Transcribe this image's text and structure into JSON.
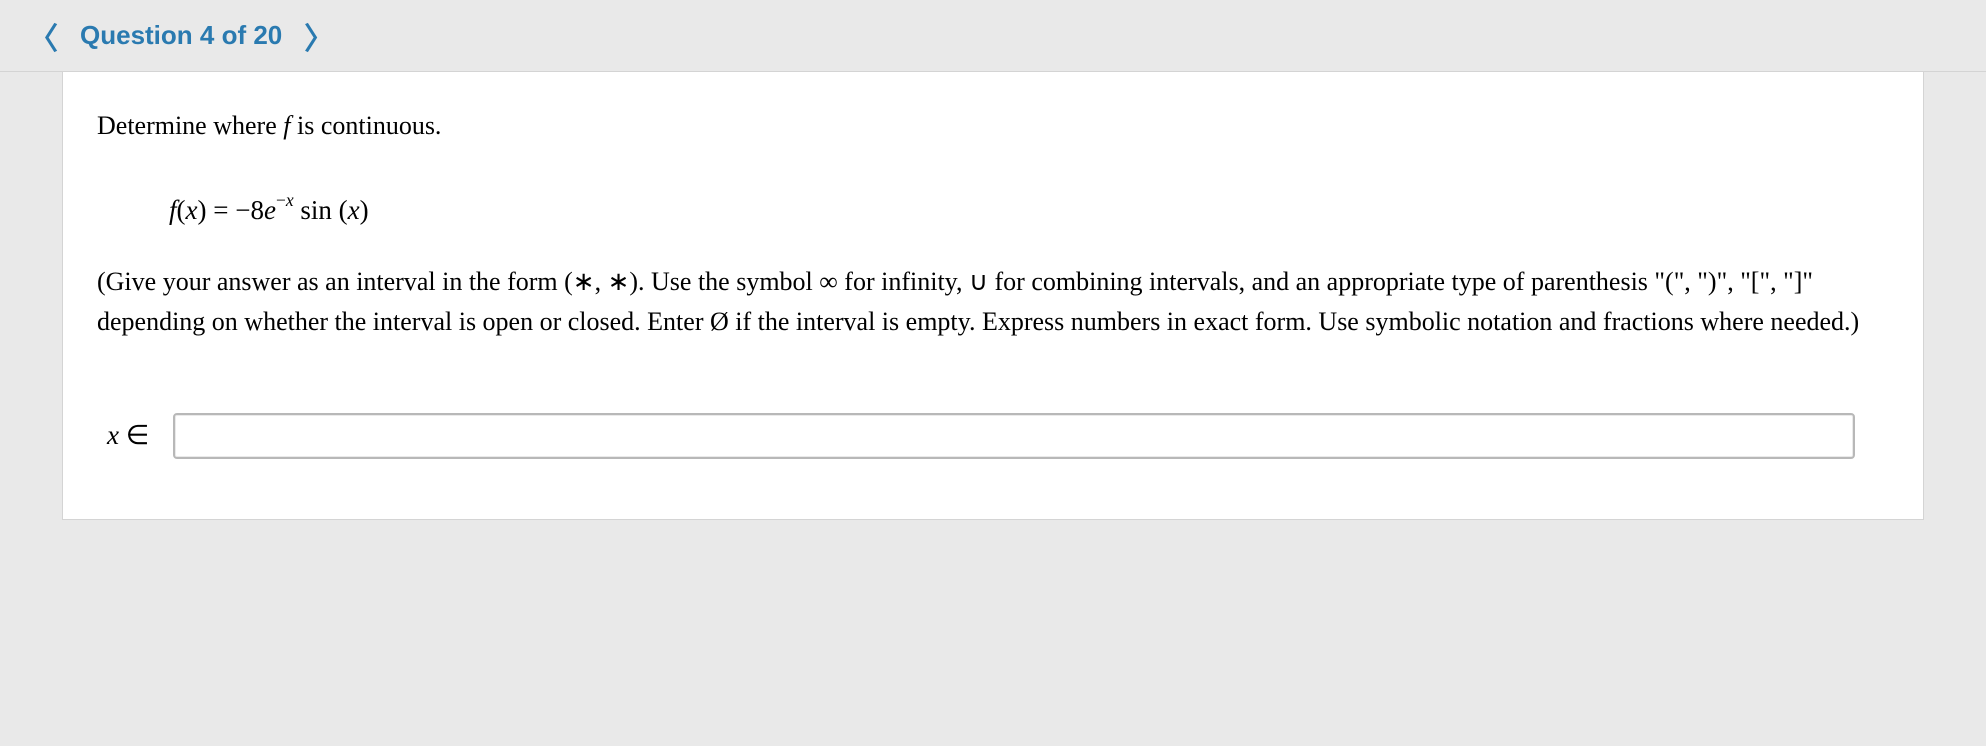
{
  "header": {
    "prev_icon_glyph": "〈",
    "next_icon_glyph": "〉",
    "question_label": "Question 4 of 20"
  },
  "content": {
    "prompt_prefix": "Determine where ",
    "prompt_var": "f",
    "prompt_suffix": " is continuous.",
    "formula": {
      "lhs_f": "f",
      "lhs_open": "(",
      "lhs_x": "x",
      "lhs_close": ") = −8",
      "e": "e",
      "exp_minus": "−",
      "exp_x": "x",
      "space": " sin (",
      "arg_x": "x",
      "tail": ")"
    },
    "instructions": "(Give your answer as an interval in the form (∗, ∗). Use the symbol ∞ for infinity, ∪ for combining intervals, and an appropriate type of parenthesis \"(\", \")\", \"[\", \"]\" depending on whether the interval is open or closed. Enter Ø if the interval is empty. Express numbers in exact form. Use symbolic notation and fractions where needed.)",
    "answer_label_x": "x",
    "answer_label_in": " ∈",
    "answer_value": ""
  }
}
